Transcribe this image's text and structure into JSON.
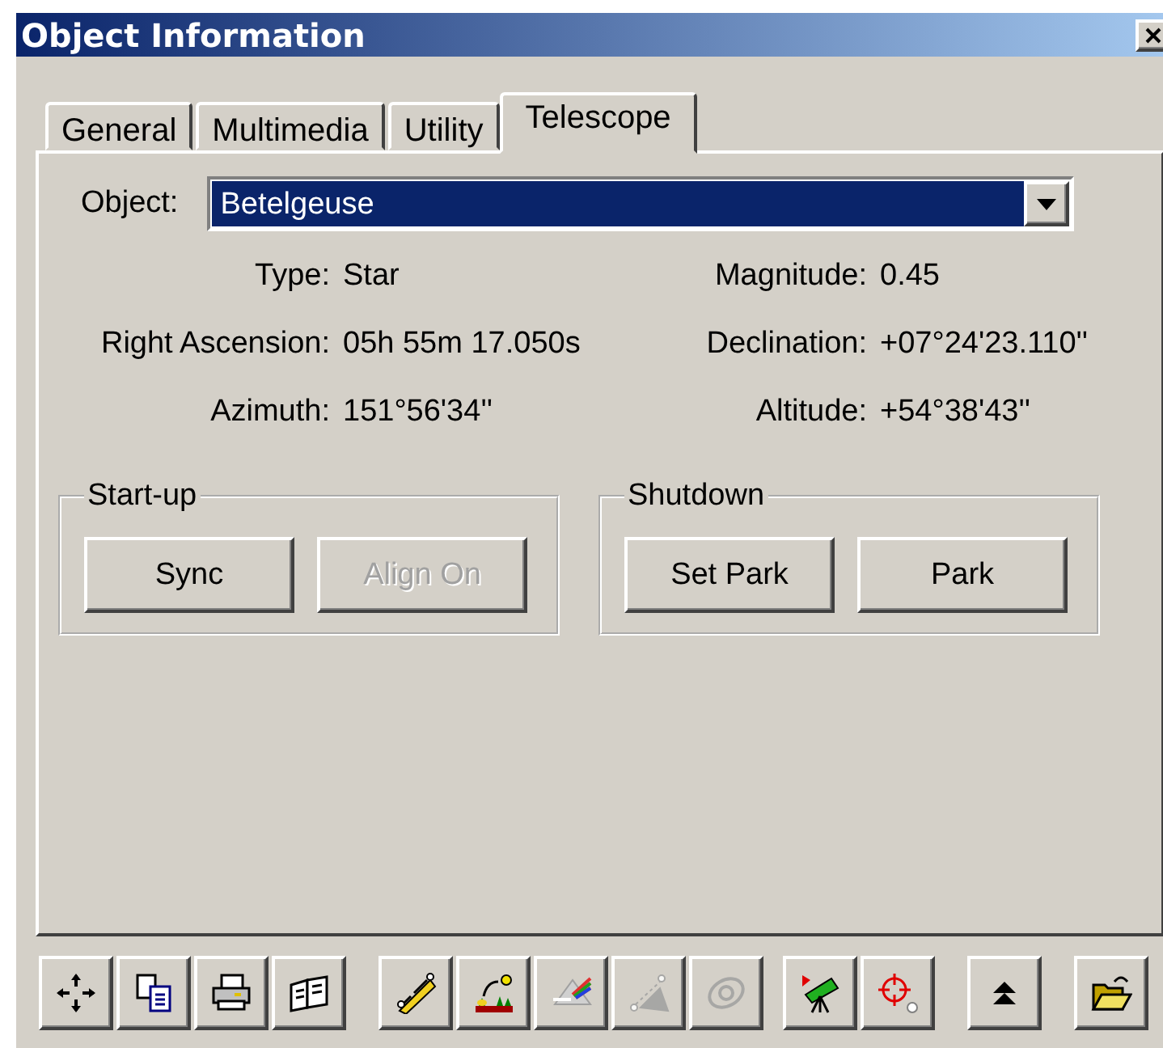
{
  "window": {
    "title": "Object Information"
  },
  "tabs": [
    {
      "label": "General",
      "selected": false
    },
    {
      "label": "Multimedia",
      "selected": false
    },
    {
      "label": "Utility",
      "selected": false
    },
    {
      "label": "Telescope",
      "selected": true
    }
  ],
  "object": {
    "label": "Object:",
    "value": "Betelgeuse"
  },
  "fields": [
    {
      "label": "Type:",
      "value": "Star"
    },
    {
      "label": "Magnitude:",
      "value": "0.45"
    },
    {
      "label": "Right Ascension:",
      "value": "05h 55m 17.050s"
    },
    {
      "label": "Declination:",
      "value": "+07°24'23.110''"
    },
    {
      "label": "Azimuth:",
      "value": "151°56'34''"
    },
    {
      "label": "Altitude:",
      "value": "+54°38'43''"
    }
  ],
  "groups": [
    {
      "title": "Start-up",
      "buttons": [
        {
          "label": "Sync",
          "disabled": false
        },
        {
          "label": "Align On",
          "disabled": true
        }
      ]
    },
    {
      "title": "Shutdown",
      "buttons": [
        {
          "label": "Set Park",
          "disabled": false
        },
        {
          "label": "Park",
          "disabled": false
        }
      ]
    }
  ],
  "toolbar": [
    [
      {
        "kind": "move",
        "disabled": false
      },
      {
        "kind": "copy",
        "disabled": false
      },
      {
        "kind": "print",
        "disabled": false
      },
      {
        "kind": "book",
        "disabled": false
      }
    ],
    [
      {
        "kind": "ruler",
        "disabled": false
      },
      {
        "kind": "landscape",
        "disabled": false
      },
      {
        "kind": "prism",
        "disabled": false
      },
      {
        "kind": "measure",
        "disabled": true
      },
      {
        "kind": "orbit",
        "disabled": true
      }
    ],
    [
      {
        "kind": "telescope",
        "disabled": false
      },
      {
        "kind": "crosshair",
        "disabled": false
      }
    ],
    [
      {
        "kind": "up",
        "disabled": false
      }
    ],
    [
      {
        "kind": "folder",
        "disabled": false
      }
    ]
  ]
}
